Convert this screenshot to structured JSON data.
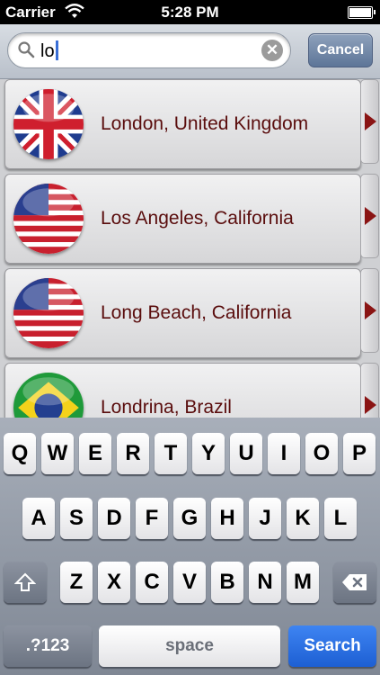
{
  "status": {
    "carrier": "Carrier",
    "time": "5:28 PM"
  },
  "search": {
    "query": "lo",
    "clear_glyph": "✕",
    "cancel_label": "Cancel"
  },
  "results": [
    {
      "label": "London, United Kingdom",
      "flag": "uk-flag-icon"
    },
    {
      "label": "Los Angeles, California",
      "flag": "us-flag-icon"
    },
    {
      "label": "Long Beach, California",
      "flag": "us-flag-icon"
    },
    {
      "label": "Londrina, Brazil",
      "flag": "brazil-flag-icon"
    }
  ],
  "keyboard": {
    "row1": [
      "Q",
      "W",
      "E",
      "R",
      "T",
      "Y",
      "U",
      "I",
      "O",
      "P"
    ],
    "row2": [
      "A",
      "S",
      "D",
      "F",
      "G",
      "H",
      "J",
      "K",
      "L"
    ],
    "row3": [
      "Z",
      "X",
      "C",
      "V",
      "B",
      "N",
      "M"
    ],
    "numbers_label": ".?123",
    "space_label": "space",
    "search_label": "Search"
  }
}
